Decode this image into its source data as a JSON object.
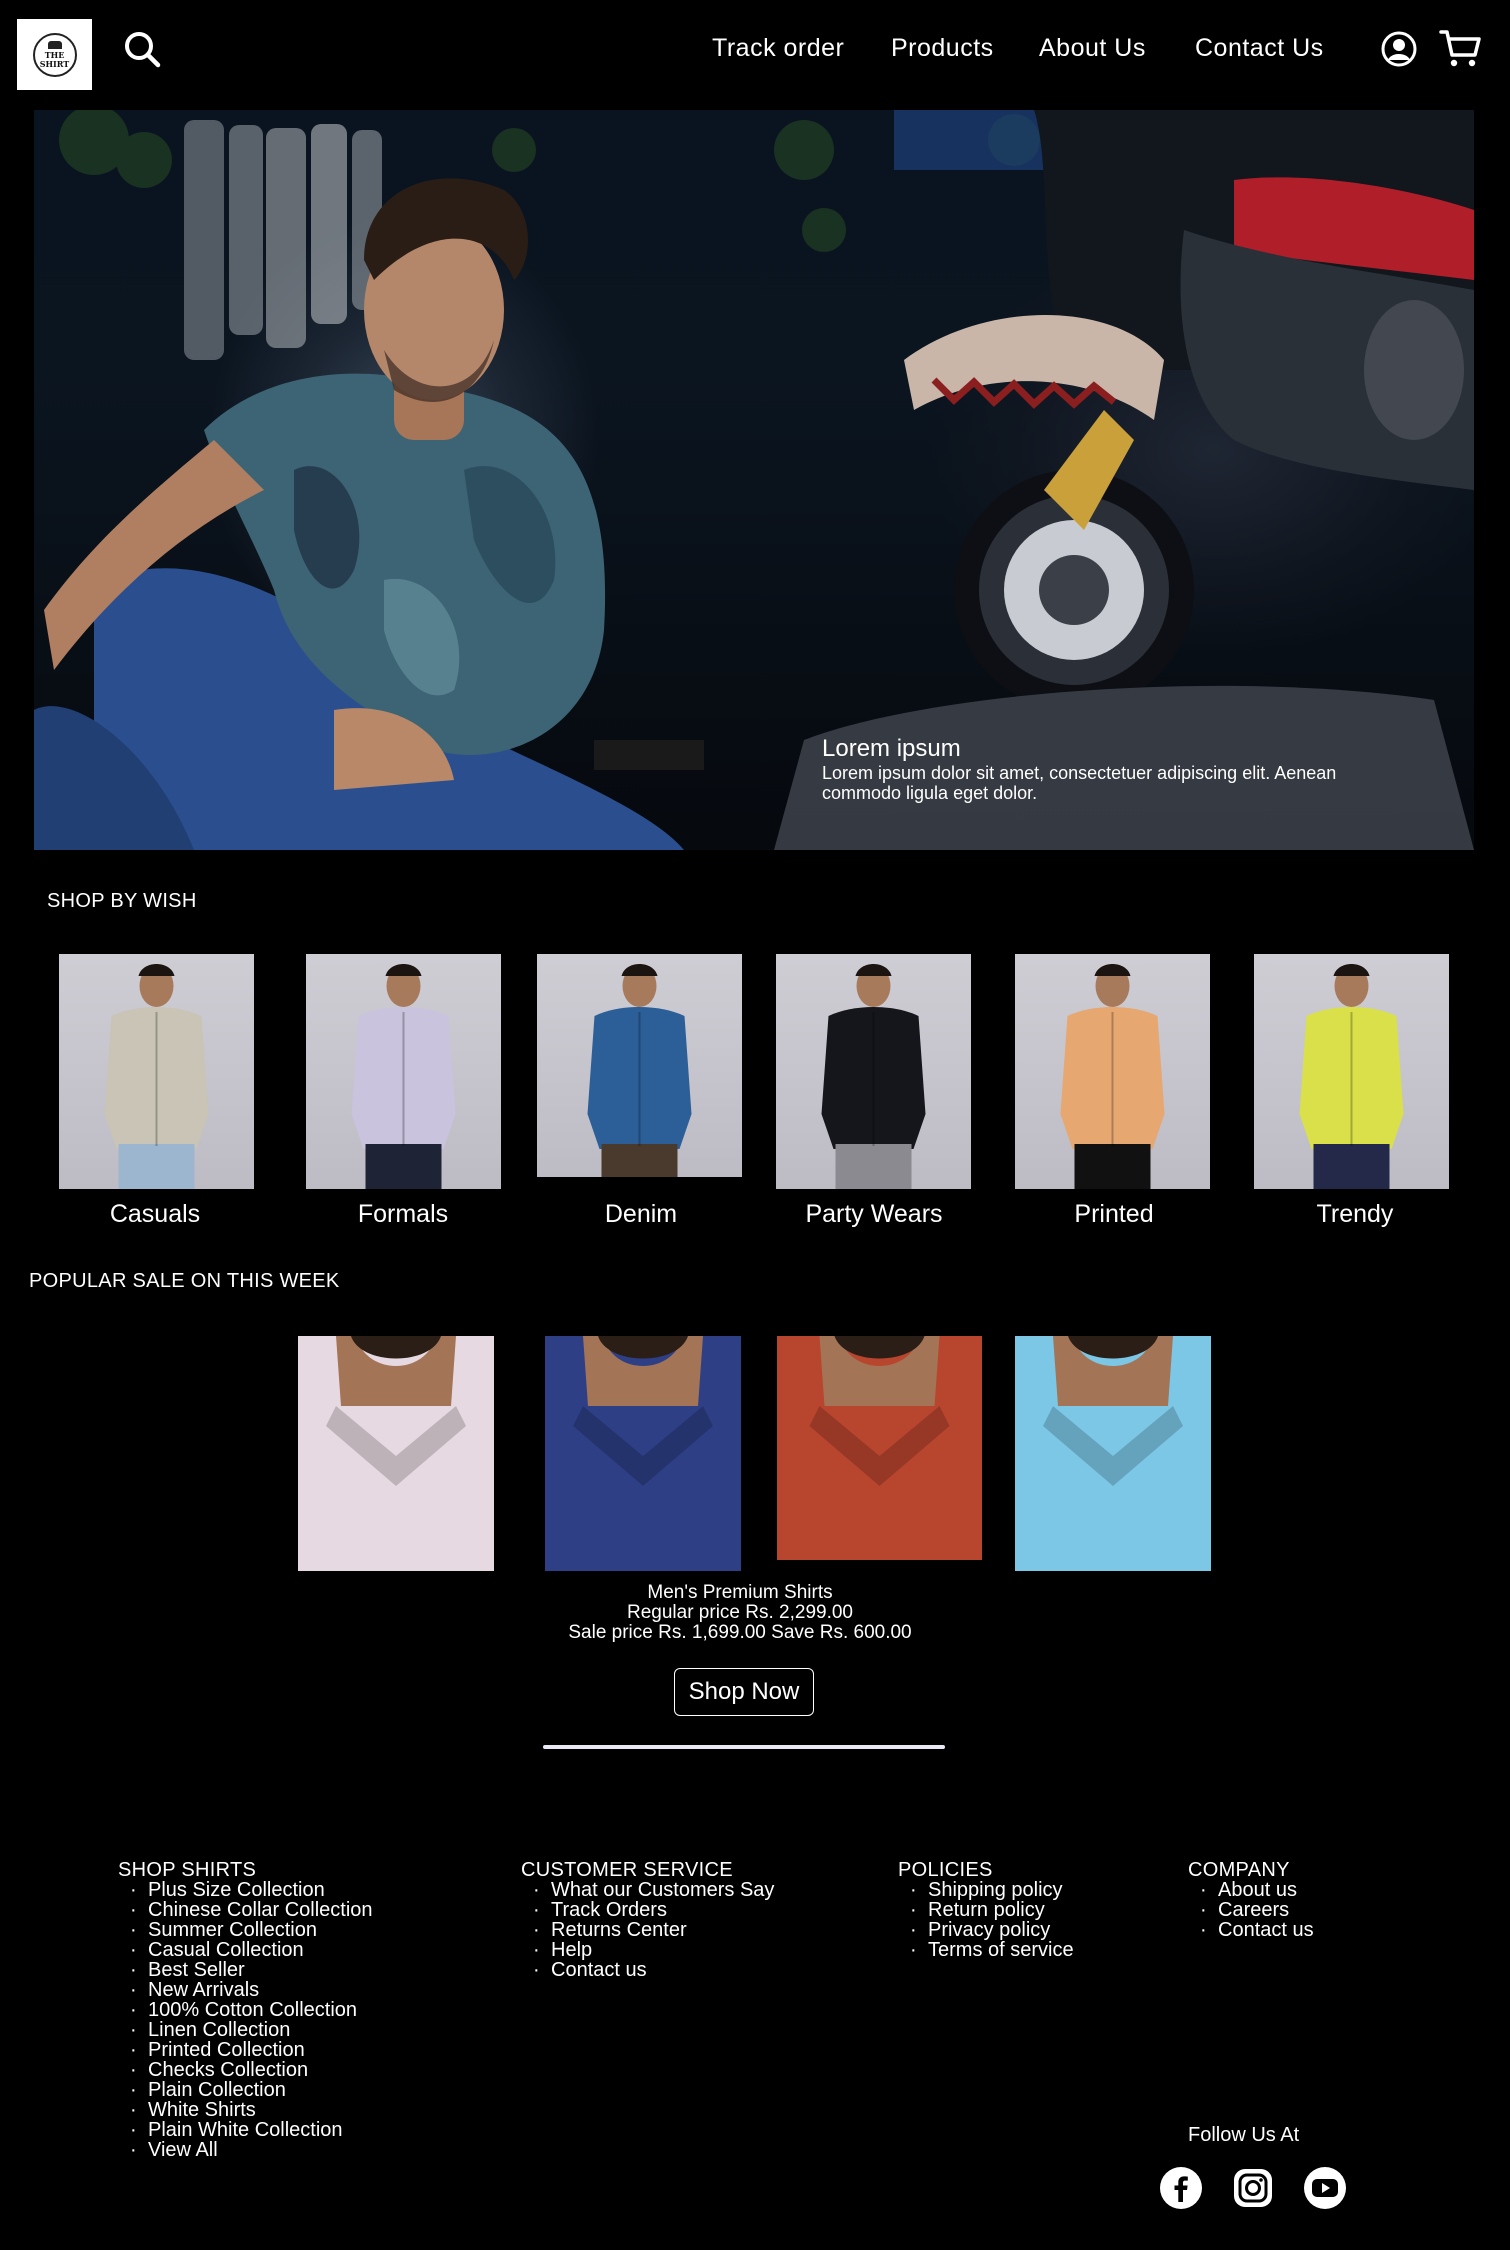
{
  "header": {
    "logo_text": "THE SHIRT",
    "nav": [
      "Track order",
      "Products",
      "About Us",
      "Contact Us"
    ]
  },
  "hero": {
    "title": "Lorem ipsum",
    "text": "Lorem ipsum dolor sit amet, consectetuer adipiscing elit. Aenean commodo ligula eget dolor."
  },
  "shop_by_wish": {
    "title": "SHOP BY WISH",
    "categories": [
      {
        "label": "Casuals",
        "shirt_color": "#c9c4b5",
        "pants_color": "#9db6cf"
      },
      {
        "label": "Formals",
        "shirt_color": "#c9c3dd",
        "pants_color": "#1e2436"
      },
      {
        "label": "Denim",
        "shirt_color": "#2c5f98",
        "pants_color": "#4a3a2e"
      },
      {
        "label": "Party Wears",
        "shirt_color": "#15161c",
        "pants_color": "#8a8a90"
      },
      {
        "label": "Printed",
        "shirt_color": "#e6a770",
        "pants_color": "#111111"
      },
      {
        "label": "Trendy",
        "shirt_color": "#d9e04a",
        "pants_color": "#24294a"
      }
    ]
  },
  "popular_sale": {
    "title": "POPULAR SALE ON THIS WEEK",
    "product_name": "Men's Premium Shirts",
    "regular_price": "Regular price Rs. 2,299.00",
    "sale_price": "Sale price Rs. 1,699.00 Save Rs. 600.00",
    "button": "Shop Now",
    "images": [
      {
        "shirt_color": "#e7d9e1"
      },
      {
        "shirt_color": "#2e3f86"
      },
      {
        "shirt_color": "#b8452e"
      },
      {
        "shirt_color": "#7cc7e6"
      }
    ]
  },
  "footer": {
    "shop_shirts": {
      "title": "SHOP SHIRTS",
      "items": [
        "Plus Size Collection",
        "Chinese Collar Collection",
        "Summer Collection",
        "Casual Collection",
        "Best Seller",
        "New Arrivals",
        "100% Cotton Collection",
        "Linen Collection",
        "Printed Collection",
        "Checks Collection",
        "Plain Collection",
        "White Shirts",
        "Plain White Collection",
        "View All"
      ]
    },
    "customer_service": {
      "title": "CUSTOMER SERVICE",
      "items": [
        "What our Customers Say",
        "Track Orders",
        "Returns Center",
        "Help",
        "Contact us"
      ]
    },
    "policies": {
      "title": "POLICIES",
      "items": [
        "Shipping policy",
        "Return policy",
        "Privacy policy",
        "Terms of service"
      ]
    },
    "company": {
      "title": "COMPANY",
      "items": [
        "About us",
        "Careers",
        "Contact us"
      ]
    },
    "follow": "Follow Us At",
    "social_icons": [
      "facebook-icon",
      "instagram-icon",
      "youtube-icon"
    ]
  }
}
